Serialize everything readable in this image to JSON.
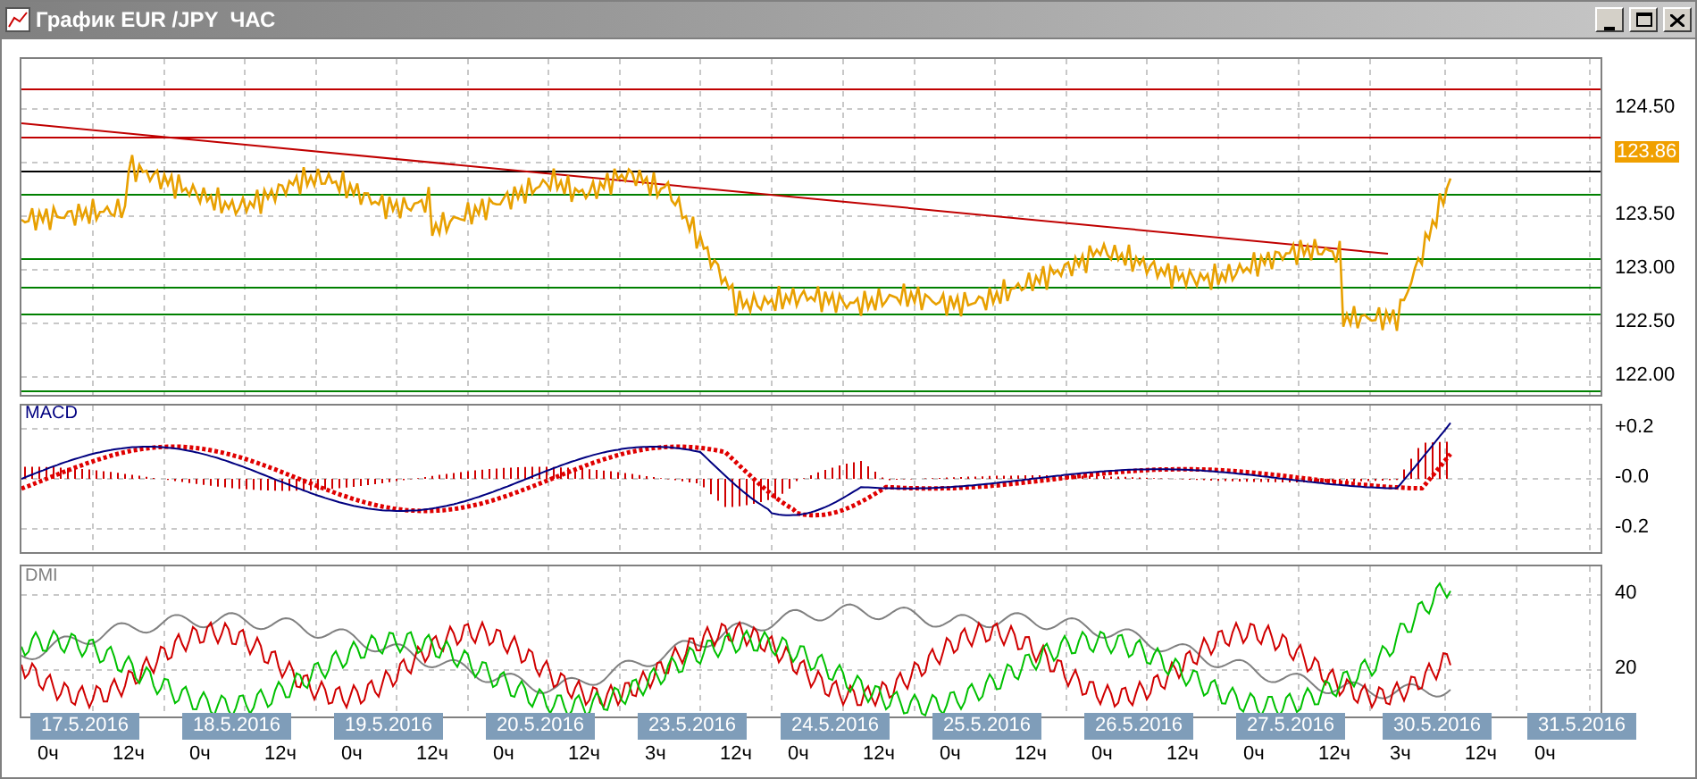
{
  "window": {
    "title": "График EUR /JPY  ЧАС"
  },
  "price_panel": {
    "axis_labels": [
      "124.50",
      "123.50",
      "123.00",
      "122.50",
      "122.00"
    ],
    "current_price": "123.86"
  },
  "macd_panel": {
    "title": "MACD",
    "axis_labels": [
      "+0.2",
      "-0.0",
      "-0.2"
    ]
  },
  "dmi_panel": {
    "title": "DMI",
    "axis_labels": [
      "40",
      "20"
    ]
  },
  "dates": [
    {
      "label": "17.5.2016",
      "hours": [
        "0ч",
        "12ч"
      ]
    },
    {
      "label": "18.5.2016",
      "hours": [
        "0ч",
        "12ч"
      ]
    },
    {
      "label": "19.5.2016",
      "hours": [
        "0ч",
        "12ч"
      ]
    },
    {
      "label": "20.5.2016",
      "hours": [
        "0ч",
        "12ч"
      ]
    },
    {
      "label": "23.5.2016",
      "hours": [
        "3ч",
        "12ч"
      ]
    },
    {
      "label": "24.5.2016",
      "hours": [
        "0ч",
        "12ч"
      ]
    },
    {
      "label": "25.5.2016",
      "hours": [
        "0ч",
        "12ч"
      ]
    },
    {
      "label": "26.5.2016",
      "hours": [
        "0ч",
        "12ч"
      ]
    },
    {
      "label": "27.5.2016",
      "hours": [
        "0ч",
        "12ч"
      ]
    },
    {
      "label": "30.5.2016",
      "hours": [
        "3ч",
        "12ч"
      ]
    },
    {
      "label": "31.5.2016",
      "hours": [
        "0ч"
      ]
    }
  ]
}
